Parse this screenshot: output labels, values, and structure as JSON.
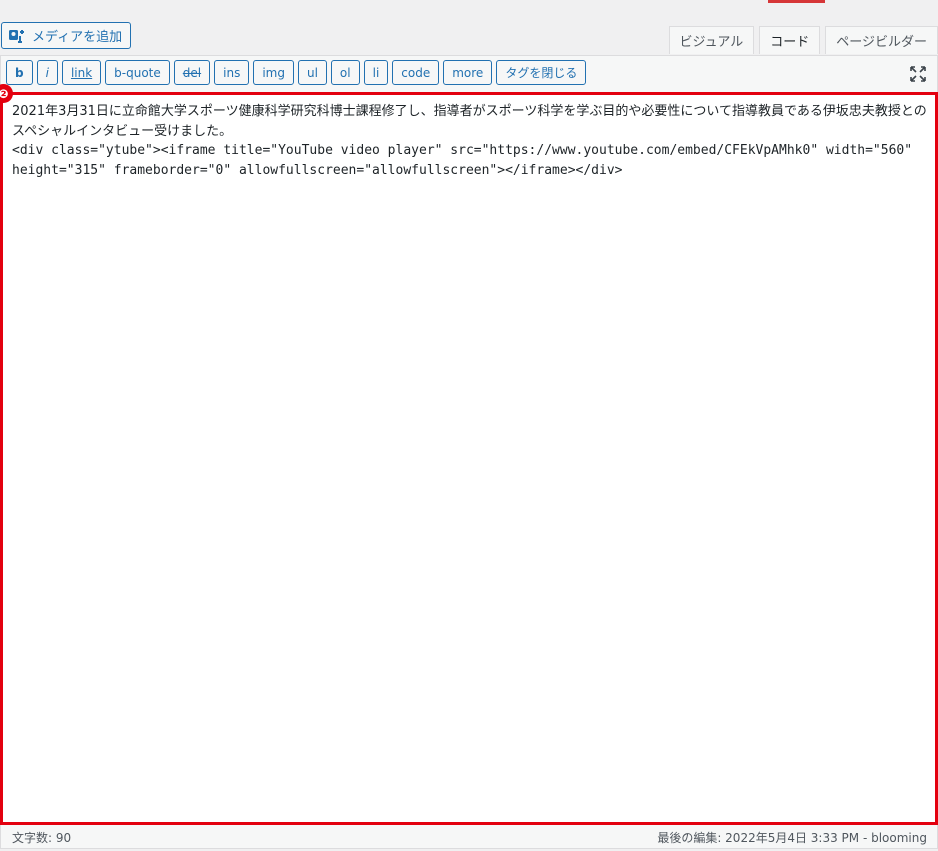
{
  "media_button": {
    "label": "メディアを追加",
    "icon": "media-add-icon"
  },
  "tabs": [
    {
      "label": "ビジュアル",
      "active": false
    },
    {
      "label": "コード",
      "active": true
    },
    {
      "label": "ページビルダー",
      "active": false
    }
  ],
  "toolbar": {
    "buttons": [
      "b",
      "i",
      "link",
      "b-quote",
      "del",
      "ins",
      "img",
      "ul",
      "ol",
      "li",
      "code",
      "more",
      "タグを閉じる"
    ],
    "fullscreen_icon": "fullscreen-icon"
  },
  "editor": {
    "badge": "❷",
    "line1": "2021年3月31日に立命館大学スポーツ健康科学研究科博士課程修了し、指導者がスポーツ科学を学ぶ目的や必要性について指導教員である伊坂忠夫教授とのスペシャルインタビュー受けました。",
    "line2": "<div class=\"ytube\"><iframe title=\"YouTube video player\" src=\"https://www.youtube.com/embed/CFEkVpAMhk0\" width=\"560\" height=\"315\" frameborder=\"0\" allowfullscreen=\"allowfullscreen\"></iframe></div>"
  },
  "status_bar": {
    "word_count": "文字数: 90",
    "last_edit": "最後の編集: 2022年5月4日 3:33 PM - blooming"
  },
  "colors": {
    "accent": "#2271b1",
    "highlight": "#e3000f"
  }
}
